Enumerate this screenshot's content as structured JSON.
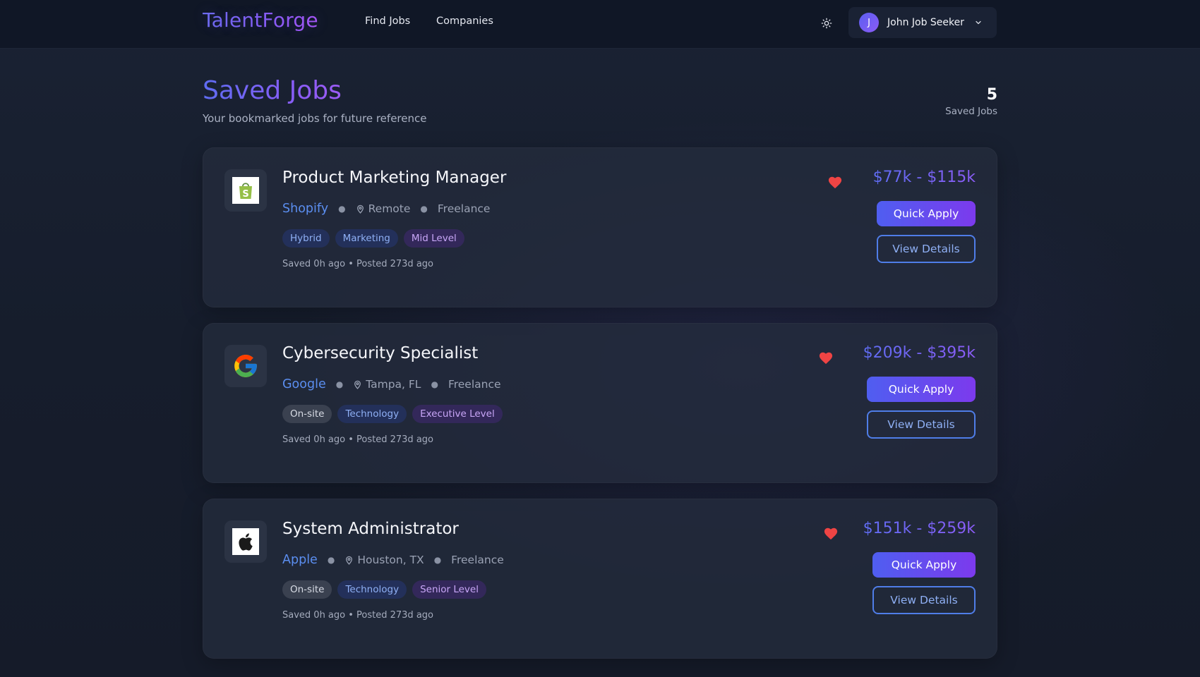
{
  "app": {
    "logo": "TalentForge"
  },
  "nav": {
    "find_jobs": "Find Jobs",
    "companies": "Companies"
  },
  "user": {
    "initial": "J",
    "name": "John Job Seeker"
  },
  "page": {
    "title": "Saved Jobs",
    "subtitle": "Your bookmarked jobs for future reference",
    "count": "5",
    "count_label": "Saved Jobs"
  },
  "colors": {
    "accent_blue": "#4f5ef0",
    "accent_purple": "#7c3aed",
    "heart_red": "#ef4444",
    "company_link": "#5b8ef0"
  },
  "jobs": [
    {
      "title": "Product Marketing Manager",
      "company": "Shopify",
      "company_icon": "shopify-logo-icon",
      "location": "Remote",
      "type": "Freelance",
      "tags": [
        "Hybrid",
        "Marketing",
        "Mid Level"
      ],
      "saved_meta": "Saved 0h ago • Posted 273d ago",
      "salary": "$77k - $115k",
      "apply_label": "Quick Apply",
      "details_label": "View Details"
    },
    {
      "title": "Cybersecurity Specialist",
      "company": "Google",
      "company_icon": "google-logo-icon",
      "location": "Tampa, FL",
      "type": "Freelance",
      "tags": [
        "On-site",
        "Technology",
        "Executive Level"
      ],
      "saved_meta": "Saved 0h ago • Posted 273d ago",
      "salary": "$209k - $395k",
      "apply_label": "Quick Apply",
      "details_label": "View Details"
    },
    {
      "title": "System Administrator",
      "company": "Apple",
      "company_icon": "apple-logo-icon",
      "location": "Houston, TX",
      "type": "Freelance",
      "tags": [
        "On-site",
        "Technology",
        "Senior Level"
      ],
      "saved_meta": "Saved 0h ago • Posted 273d ago",
      "salary": "$151k - $259k",
      "apply_label": "Quick Apply",
      "details_label": "View Details"
    }
  ]
}
